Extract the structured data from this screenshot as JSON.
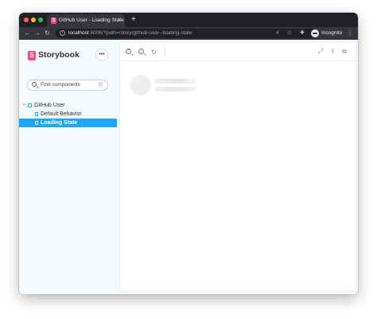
{
  "browser": {
    "tab_title": "GitHub User - Loading State",
    "tab_close": "×",
    "new_tab": "+",
    "url_host": "localhost",
    "url_path": ":6006/?path=/story/github-user--loading-state",
    "profile_label": "Incognito",
    "traffic_lights": [
      "#ff5f57",
      "#febc2e",
      "#28c840"
    ]
  },
  "storybook": {
    "logo_letter": "S",
    "title": "Storybook",
    "menu_dots": "•••",
    "search_placeholder": "Find components",
    "search_shortcut": "/",
    "tree": {
      "component": "GitHub User",
      "stories": [
        "Default Behavior",
        "Loading State"
      ],
      "selected": "Loading State"
    },
    "accent": "#1ea7fd",
    "brand": "#ff4785"
  },
  "canvas": {
    "zoom_in": "+",
    "zoom_out": "−",
    "reset": "↻"
  }
}
